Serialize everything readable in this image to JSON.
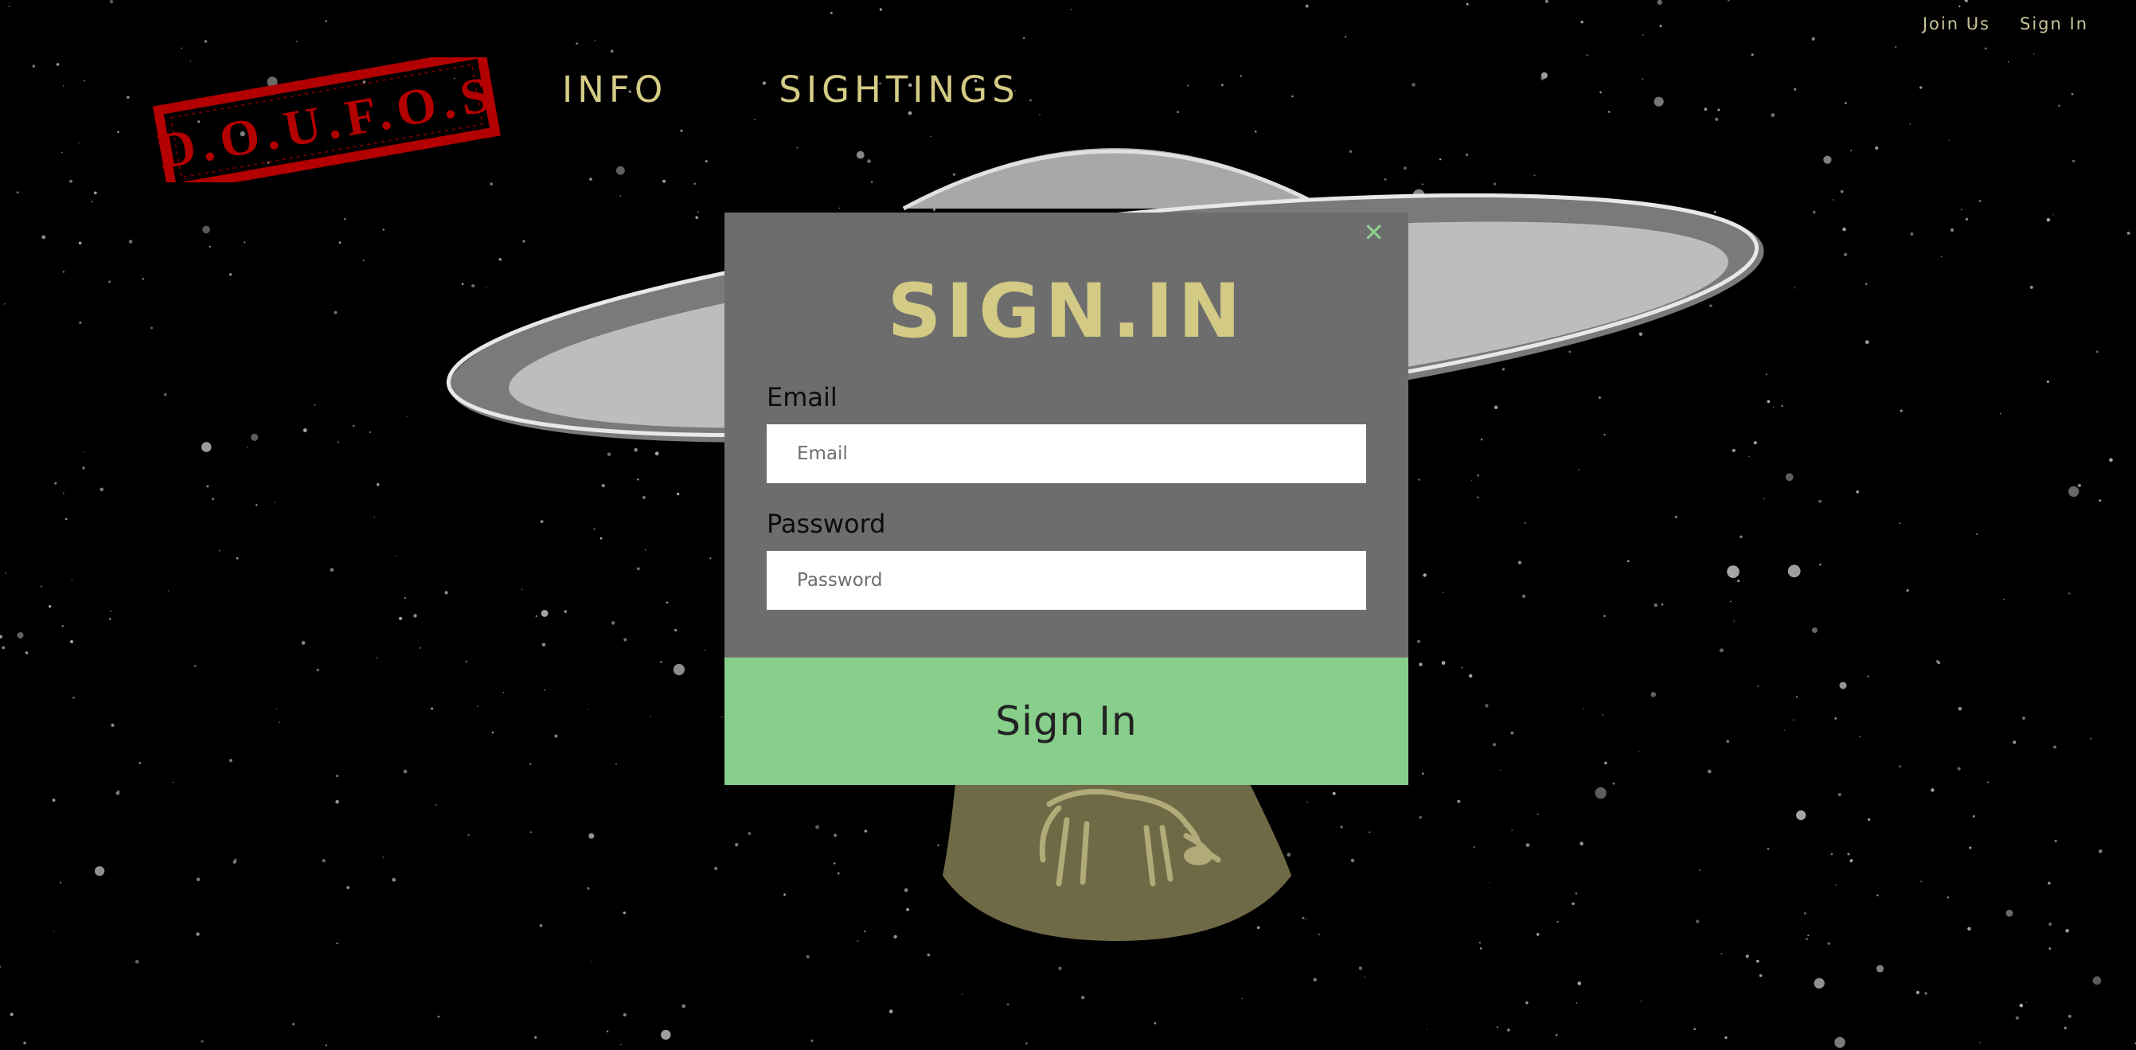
{
  "logo": {
    "text": "D.O.U.F.O.S",
    "color": "#b30000"
  },
  "top_links": [
    {
      "label": "Join Us"
    },
    {
      "label": "Sign In"
    }
  ],
  "nav": {
    "items": [
      {
        "label": "INFO"
      },
      {
        "label": "SIGHTINGS"
      }
    ]
  },
  "modal": {
    "close_icon": "close-icon",
    "close_glyph": "✕",
    "title": "SIGN.IN",
    "email": {
      "label": "Email",
      "placeholder": "Email",
      "value": ""
    },
    "password": {
      "label": "Password",
      "placeholder": "Password",
      "value": ""
    },
    "submit_label": "Sign In"
  },
  "colors": {
    "background": "#000000",
    "accent_yellow": "#d2ca85",
    "accent_green": "#88cf8b",
    "modal_bg": "#6d6d6d"
  }
}
